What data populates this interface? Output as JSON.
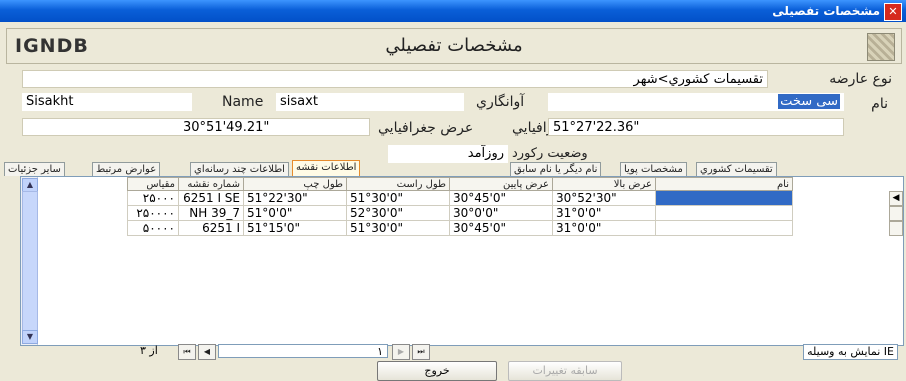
{
  "window": {
    "title": "مشخصات تفصيلى"
  },
  "header": {
    "app_name": "IGNDB",
    "title": "مشخصات تفصيلي"
  },
  "fields": {
    "feature_type_label": "نوع عارضه",
    "feature_type_value": "تقسيمات كشوري>شهر",
    "name_label": "نام",
    "name_value": "سی سخت",
    "phonetic_label": "آوانگاري",
    "phonetic_value": "sisaxt",
    "name_en_label": "Name",
    "name_en_value": "Sisakht",
    "lat_label": "عرض جغرافيايي",
    "lat_value": "30°51'49.21\"",
    "lon_label": "طول جغرافيايي",
    "lon_value": "51°27'22.36\"",
    "status_label": "وضعيت ركورد",
    "status_value": "روزآمد"
  },
  "tabs": [
    "تقسيمات كشوري",
    "مشخصات پويا",
    "نام ديگر يا نام سابق",
    "اطلاعات نقشه",
    "اطلاعات چند رسانه‌اي",
    "عوارض مرتبط",
    "ساير جزئيات"
  ],
  "active_tab": "اطلاعات نقشه",
  "table": {
    "columns": [
      "مقياس",
      "شماره نقشه",
      "طول چپ",
      "طول راست",
      "عرض پايين",
      "عرض بالا",
      "نام"
    ],
    "rows": [
      [
        "۲۵۰۰۰",
        "6251 I SE",
        "51°22'30\"",
        "51°30'0\"",
        "30°45'0\"",
        "30°52'30\"",
        ""
      ],
      [
        "۲۵۰۰۰۰",
        "NH 39_7",
        "51°0'0\"",
        "52°30'0\"",
        "30°0'0\"",
        "31°0'0\"",
        ""
      ],
      [
        "۵۰۰۰۰",
        "6251 I",
        "51°15'0\"",
        "51°30'0\"",
        "30°45'0\"",
        "31°0'0\"",
        ""
      ]
    ]
  },
  "pager": {
    "current": "۱",
    "of_label": "از ۳"
  },
  "ie_link": "نمايش به وسيله IE",
  "buttons": {
    "exit": "خروج",
    "history": "سابقه تغييرات"
  },
  "colors": {
    "titlebar": "#0a5fd8",
    "selection": "#316ac5",
    "active_tab_border": "#e68b2c"
  }
}
